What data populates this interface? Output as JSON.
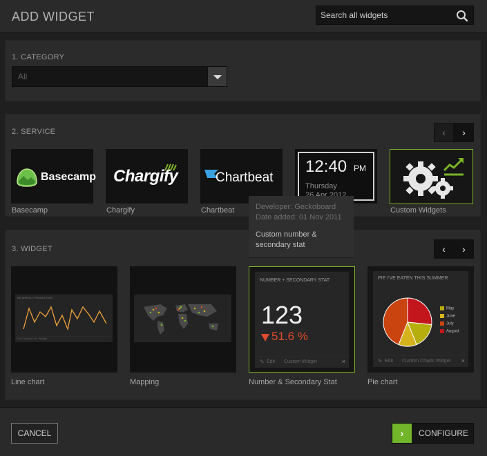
{
  "header": {
    "title": "ADD WIDGET",
    "search_placeholder": "Search all widgets",
    "search_icon": "search-icon"
  },
  "category": {
    "label": "1. CATEGORY",
    "selected": "All"
  },
  "service": {
    "label": "2. SERVICE",
    "items": [
      {
        "name": "Basecamp",
        "logo_text": "Basecamp"
      },
      {
        "name": "Chargify",
        "logo_text": "Chargify"
      },
      {
        "name": "Chartbeat",
        "logo_text": "Chartbeat"
      },
      {
        "name": "Clock",
        "time": "12:40",
        "ampm": "PM",
        "day": "Thursday",
        "date": "26 Apr 2012"
      },
      {
        "name": "Custom Widgets"
      }
    ]
  },
  "tooltip": {
    "developer": "Developer: Geckoboard",
    "date_added": "Date added: 01 Nov 2011",
    "description": "Custom number & secondary stat"
  },
  "widget": {
    "label": "3. WIDGET",
    "items": [
      {
        "name": "Line chart",
        "preview_title": "GB WEEKLY PRODUCTION",
        "footer": "Edit   Custom Line Widget"
      },
      {
        "name": "Mapping"
      },
      {
        "name": "Number & Secondary Stat",
        "preview_title": "NUMBER + SECONDARY STAT",
        "number": "123",
        "stat": "51.6 %",
        "edit": "Edit",
        "footer": "Custom Widget"
      },
      {
        "name": "Pie chart",
        "preview_title": "PIE I'VE EATEN THIS SUMMER",
        "edit": "Edit",
        "footer": "Custom Charts Widget",
        "legend": [
          "May",
          "June",
          "July",
          "August"
        ]
      }
    ]
  },
  "footer": {
    "cancel": "CANCEL",
    "configure": "CONFIGURE"
  },
  "colors": {
    "accent": "#71b62a",
    "stat_down": "#e04a2f",
    "line_chart": "#f2a33a"
  }
}
